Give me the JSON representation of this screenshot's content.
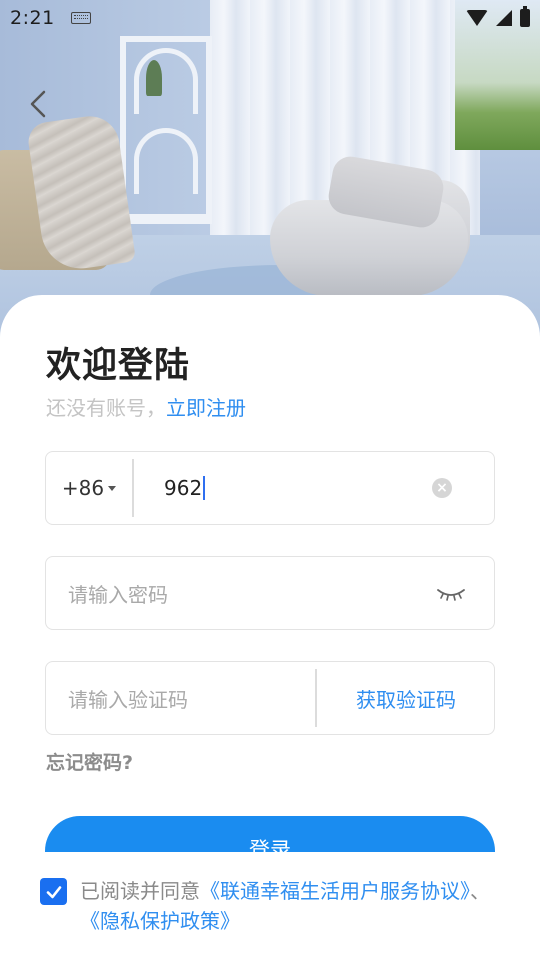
{
  "status_bar": {
    "time": "2:21",
    "icons": [
      "keyboard-icon",
      "wifi-icon",
      "signal-icon",
      "battery-icon"
    ]
  },
  "header": {
    "back_icon": "chevron-left-icon"
  },
  "login": {
    "title": "欢迎登陆",
    "subtitle_prefix": "还没有账号，",
    "register_link": "立即注册",
    "phone": {
      "country_code": "+86",
      "value": "962",
      "clear_icon": "clear-icon"
    },
    "password": {
      "placeholder": "请输入密码",
      "visibility_icon": "eye-closed-icon"
    },
    "verification": {
      "placeholder": "请输入验证码",
      "get_code_label": "获取验证码"
    },
    "forgot_label": "忘记密码?",
    "login_button": "登录",
    "agreement": {
      "checked": true,
      "prefix": "已阅读并同意",
      "terms": "《联通幸福生活用户服务协议》",
      "separator": "、",
      "privacy": "《隐私保护政策》"
    }
  },
  "colors": {
    "accent": "#1a8cf0",
    "link": "#2f8ef0",
    "title": "#222222",
    "muted": "#a9a9a9"
  }
}
